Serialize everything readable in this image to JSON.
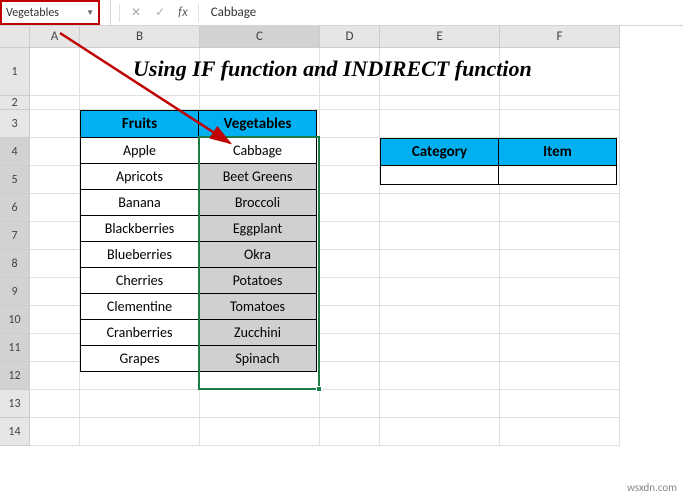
{
  "nameBox": {
    "value": "Vegetables"
  },
  "formulaBar": {
    "value": "Cabbage",
    "fx": "fx",
    "cancel": "✕",
    "confirm": "✓"
  },
  "columns": [
    "A",
    "B",
    "C",
    "D",
    "E",
    "F"
  ],
  "rows": [
    "1",
    "2",
    "3",
    "4",
    "5",
    "6",
    "7",
    "8",
    "9",
    "10",
    "11",
    "12",
    "13",
    "14"
  ],
  "title": "Using IF function and INDIRECT function",
  "mainTable": {
    "headers": [
      "Fruits",
      "Vegetables"
    ],
    "data": [
      [
        "Apple",
        "Cabbage"
      ],
      [
        "Apricots",
        "Beet Greens"
      ],
      [
        "Banana",
        "Broccoli"
      ],
      [
        "Blackberries",
        "Eggplant"
      ],
      [
        "Blueberries",
        "Okra"
      ],
      [
        "Cherries",
        "Potatoes"
      ],
      [
        "Clementine",
        "Tomatoes"
      ],
      [
        "Cranberries",
        "Zucchini"
      ],
      [
        "Grapes",
        "Spinach"
      ]
    ]
  },
  "sideTable": {
    "headers": [
      "Category",
      "Item"
    ],
    "data": [
      [
        "",
        ""
      ]
    ]
  },
  "watermark": "wsxdn.com"
}
